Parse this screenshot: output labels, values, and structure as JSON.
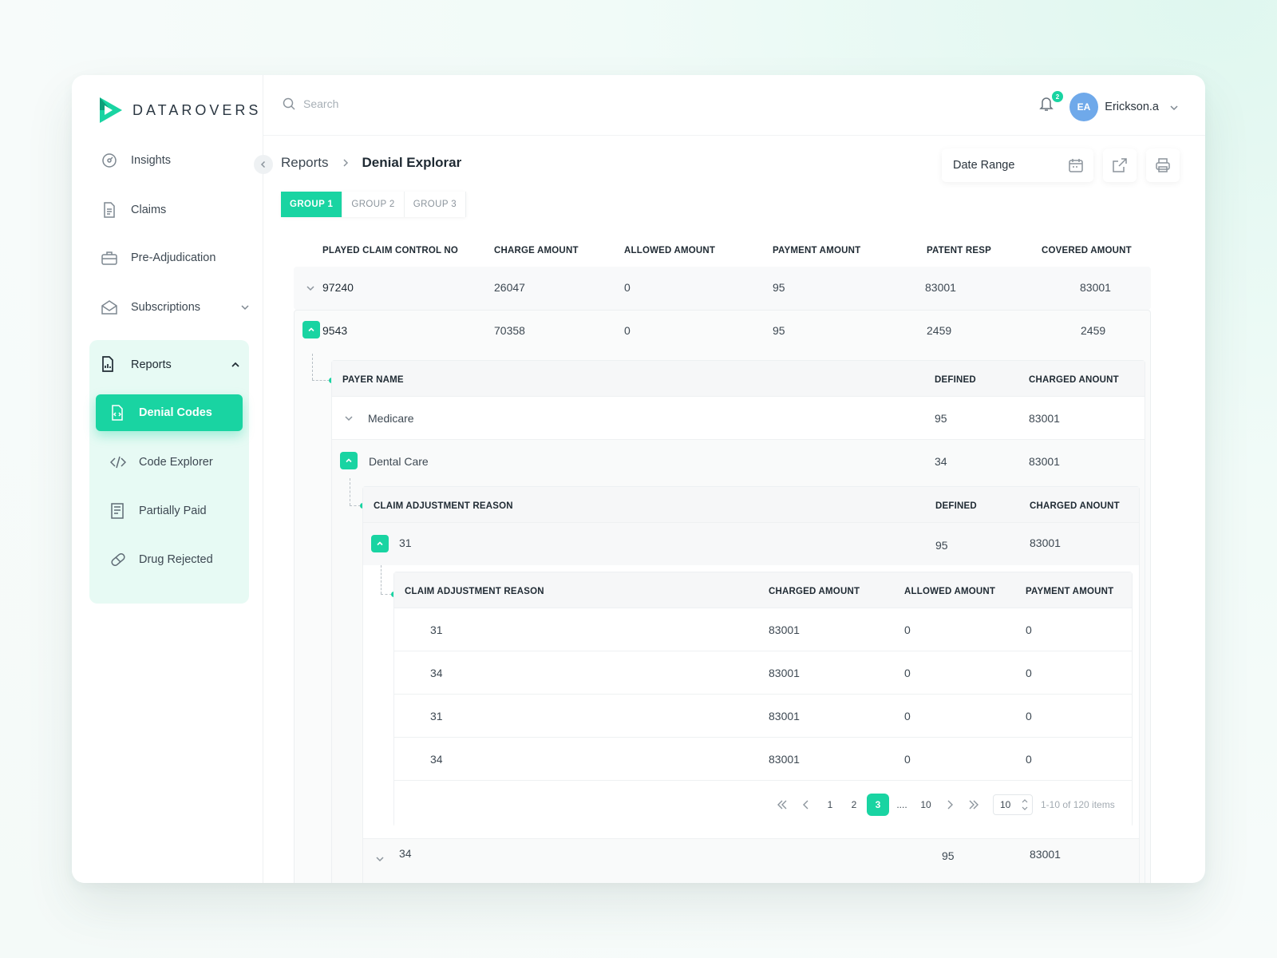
{
  "brand": {
    "name": "DATAROVERS",
    "accent": "#19d4a2"
  },
  "sidebar": {
    "items": [
      {
        "label": "Insights",
        "icon": "insights-icon"
      },
      {
        "label": "Claims",
        "icon": "document-icon"
      },
      {
        "label": "Pre-Adjudication",
        "icon": "briefcase-icon"
      },
      {
        "label": "Subscriptions",
        "icon": "envelope-icon"
      }
    ],
    "reports": {
      "label": "Reports",
      "children": [
        {
          "label": "Denial Codes",
          "active": true
        },
        {
          "label": "Code Explorer"
        },
        {
          "label": "Partially Paid"
        },
        {
          "label": "Drug Rejected"
        }
      ]
    }
  },
  "header": {
    "search_placeholder": "Search",
    "notification_count": "2",
    "user_initials": "EA",
    "user_name": "Erickson.a"
  },
  "breadcrumb": {
    "root": "Reports",
    "current": "Denial Explorar"
  },
  "toolbar": {
    "date_range_label": "Date Range"
  },
  "tabs": [
    "GROUP 1",
    "GROUP 2",
    "GROUP 3"
  ],
  "table": {
    "columns": [
      "PLAYED CLAIM CONTROL NO",
      "CHARGE AMOUNT",
      "ALLOWED AMOUNT",
      "PAYMENT AMOUNT",
      "PATENT RESP",
      "COVERED AMOUNT"
    ],
    "rows": [
      {
        "claim_no": "97240",
        "charge": "26047",
        "allowed": "0",
        "payment": "95",
        "patent_resp": "83001",
        "covered": "83001"
      },
      {
        "claim_no": "9543",
        "charge": "70358",
        "allowed": "0",
        "payment": "95",
        "patent_resp": "2459",
        "covered": "2459"
      }
    ]
  },
  "payer_table": {
    "columns": [
      "PAYER NAME",
      "DEFINED",
      "CHARGED ANOUNT"
    ],
    "rows": [
      {
        "name": "Medicare",
        "defined": "95",
        "charged": "83001"
      },
      {
        "name": "Dental Care",
        "defined": "34",
        "charged": "83001"
      }
    ]
  },
  "reason_table": {
    "columns": [
      "CLAIM ADJUSTMENT REASON",
      "DEFINED",
      "CHARGED ANOUNT"
    ],
    "rows": [
      {
        "code": "31",
        "defined": "95",
        "charged": "83001"
      },
      {
        "code": "34",
        "defined": "95",
        "charged": "83001"
      }
    ]
  },
  "detail_table": {
    "columns": [
      "CLAIM ADJUSTMENT REASON",
      "CHARGED AMOUNT",
      "ALLOWED AMOUNT",
      "PAYMENT AMOUNT"
    ],
    "rows": [
      {
        "code": "31",
        "charged": "83001",
        "allowed": "0",
        "payment": "0"
      },
      {
        "code": "34",
        "charged": "83001",
        "allowed": "0",
        "payment": "0"
      },
      {
        "code": "31",
        "charged": "83001",
        "allowed": "0",
        "payment": "0"
      },
      {
        "code": "34",
        "charged": "83001",
        "allowed": "0",
        "payment": "0"
      }
    ]
  },
  "pagination": {
    "pages": [
      "1",
      "2",
      "3",
      "....",
      "10"
    ],
    "current": "3",
    "per_page": "10",
    "info": "1-10 of 120 items"
  }
}
